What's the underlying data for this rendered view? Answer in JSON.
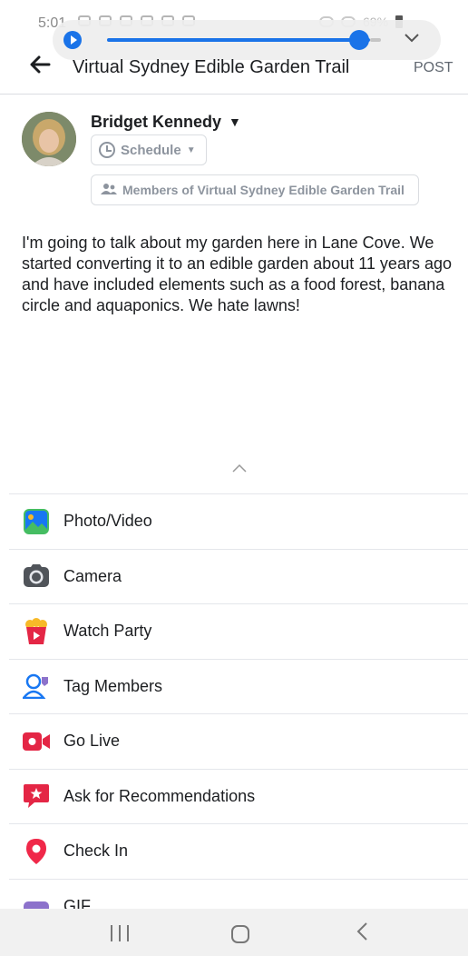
{
  "status_bar": {
    "time": "5:01",
    "battery_text": "69%"
  },
  "header": {
    "back_icon": "arrow-left-icon",
    "title": "Virtual Sydney Edible Garden Trail",
    "post_label": "POST"
  },
  "author": {
    "name": "Bridget Kennedy",
    "schedule_label": "Schedule",
    "audience_label": "Members of Virtual Sydney Edible Garden Trail"
  },
  "post": {
    "text": "I'm going to talk about my garden here in Lane Cove. We started converting it to an edible garden about 11 years ago and have included elements such as a food forest, banana circle and aquaponics. We hate lawns!"
  },
  "options": [
    {
      "label": "Photo/Video",
      "icon": "photo-video-icon",
      "color": "#45bd62"
    },
    {
      "label": "Camera",
      "icon": "camera-icon",
      "color": "#50545a"
    },
    {
      "label": "Watch Party",
      "icon": "watch-party-icon",
      "color": "#e42645"
    },
    {
      "label": "Tag Members",
      "icon": "tag-members-icon",
      "color": "#1877f2"
    },
    {
      "label": "Go Live",
      "icon": "go-live-icon",
      "color": "#e42645"
    },
    {
      "label": "Ask for Recommendations",
      "icon": "recommendations-icon",
      "color": "#e42645"
    },
    {
      "label": "Check In",
      "icon": "check-in-icon",
      "color": "#f02849"
    },
    {
      "label": "GIF",
      "icon": "gif-icon",
      "color": "#8c72cb"
    }
  ],
  "colors": {
    "accent": "#1a73e8",
    "text": "#1c1e21",
    "muted": "#8d949e",
    "divider": "#e4e6eb"
  }
}
